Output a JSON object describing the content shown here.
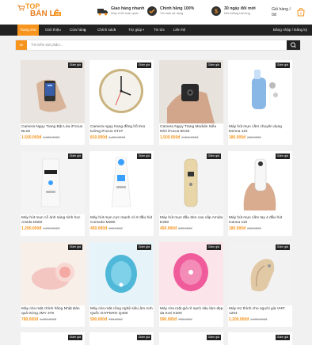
{
  "brand": {
    "line1": "TOP",
    "line2": "BÁN LẺ",
    "tag": ".VN"
  },
  "features": [
    {
      "title": "Giao hàng nhanh",
      "sub": "Ship COD toàn quốc",
      "icon": "truck-icon"
    },
    {
      "title": "Chính hãng 100%",
      "sub": "Yên tâm sử dụng",
      "icon": "badge-check-icon"
    },
    {
      "title": "30 ngày đổi mới",
      "sub": "Nếu không hài lòng",
      "icon": "refund-icon"
    }
  ],
  "cart": {
    "title": "Giỏ hàng /",
    "amount": "0đ",
    "icon": "cart-icon"
  },
  "nav": {
    "items": [
      "Trang chủ",
      "Giới thiệu",
      "Cửa hàng",
      "Chính sách",
      "Trợ giúp",
      "Tin tức",
      "Liên hệ"
    ],
    "right": "Đăng nhập / Đăng ký"
  },
  "search": {
    "category": "All",
    "placeholder": "Tìm kiếm sản phẩm..."
  },
  "badge_label": "Giảm giá",
  "products": [
    {
      "name": "Camera Ngụy Trang Bật Lửa iFocus BL02",
      "price": "1.500.000đ",
      "old": "2.500.000đ"
    },
    {
      "name": "Camera ngụy trang đồng hồ treo tường iFocus ST27",
      "price": "810.000đ",
      "old": "1.250.000đ"
    },
    {
      "name": "Camera Ngụy Trang Module Siêu Nhỏ iFocus BV20",
      "price": "1.500.000đ",
      "old": "2.250.000đ"
    },
    {
      "name": "Máy hút mụn cầm chuyên dụng Derma 110",
      "price": "180.000đ",
      "old": "220.000đ"
    },
    {
      "name": "Máy hút mụn cổ ánh sáng sinh học Amida D550",
      "price": "1.200.000đ",
      "old": "1.500.000đ"
    },
    {
      "name": "Máy hút mụn cực mạnh có 6 đầu hút Comedo M280",
      "price": "450.000đ",
      "old": "550.000đ"
    },
    {
      "name": "Máy hút mụn đầu đen cao cấp Amida E250",
      "price": "450.000đ",
      "old": "600.000đ"
    },
    {
      "name": "Máy hút mụn cầm tay 4 đầu hút Hanna 115",
      "price": "180.000đ",
      "old": "220.000đ"
    },
    {
      "name": "Máy rửa mặt chính hãng Nhật Bản quả trứng JMY 379",
      "price": "780.000đ",
      "old": "1.200.000đ"
    },
    {
      "name": "Máy rửa mặt công nghệ siêu âm Anh Quốc GIYFERO Q400",
      "price": "590.000đ",
      "old": "750.000đ"
    },
    {
      "name": "Máy rửa mặt giá rẻ sạch sâu làm đẹp da Kori K200",
      "price": "590.000đ",
      "old": "700.000đ"
    },
    {
      "name": "Máy trợ thính cho người già VHP 1204",
      "price": "2.200.000đ",
      "old": "2.600.000đ"
    }
  ]
}
